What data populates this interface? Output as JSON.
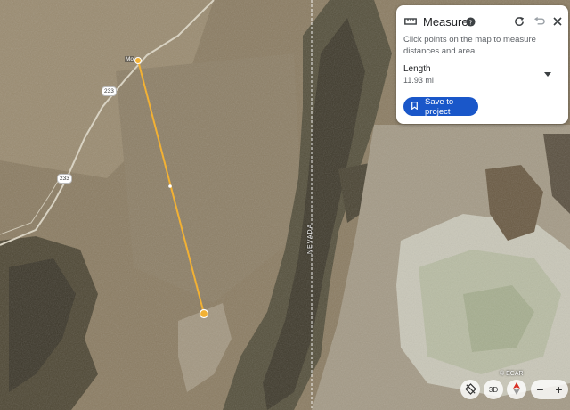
{
  "measure_panel": {
    "title": "Measure",
    "hint": "Click points on the map to measure distances and area",
    "length_label": "Length",
    "length_value": "11.93 mi",
    "save_label": "Save to project",
    "accent_color": "#1a57c9"
  },
  "map": {
    "highway_shields": [
      "233",
      "233"
    ],
    "town_label": "Mo",
    "state_label": "NEVADA",
    "attribution": "© ECAR",
    "measure_line_color": "#f2b134"
  },
  "map_controls": {
    "view_3d_label": "3D",
    "zoom_out": "−",
    "zoom_in": "+"
  },
  "icons": [
    "ruler-icon",
    "help-icon",
    "redo-icon",
    "undo-icon",
    "close-icon",
    "bookmark-icon",
    "tilt-icon",
    "compass-icon"
  ]
}
